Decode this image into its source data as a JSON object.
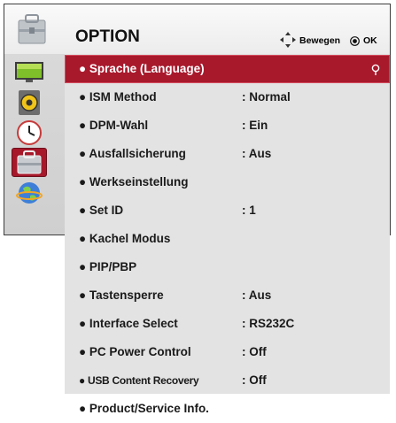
{
  "header": {
    "title": "OPTION",
    "nav_label": "Bewegen",
    "ok_label": "OK"
  },
  "sidebar": {
    "items": [
      {
        "icon": "picture-icon",
        "active": false
      },
      {
        "icon": "audio-icon",
        "active": false
      },
      {
        "icon": "time-icon",
        "active": false
      },
      {
        "icon": "option-icon",
        "active": true
      },
      {
        "icon": "network-icon",
        "active": false
      }
    ]
  },
  "menu": {
    "items": [
      {
        "label": "● Sprache (Language)",
        "value": "",
        "selected": true
      },
      {
        "label": "● ISM Method",
        "value": ": Normal"
      },
      {
        "label": "● DPM-Wahl",
        "value": ": Ein"
      },
      {
        "label": "● Ausfallsicherung",
        "value": ": Aus"
      },
      {
        "label": "● Werkseinstellung",
        "value": ""
      },
      {
        "label": "● Set ID",
        "value": ": 1"
      },
      {
        "label": "● Kachel Modus",
        "value": ""
      },
      {
        "label": "● PIP/PBP",
        "value": ""
      },
      {
        "label": "● Tastensperre",
        "value": ": Aus"
      },
      {
        "label": "● Interface Select",
        "value": ": RS232C"
      },
      {
        "label": "● PC Power Control",
        "value": ": Off"
      },
      {
        "label": "● USB Content Recovery",
        "value": ": Off"
      },
      {
        "label": "● Product/Service Info.",
        "value": ""
      }
    ]
  },
  "colors": {
    "selected": "#a8192c",
    "panel": "#e3e3e3"
  }
}
